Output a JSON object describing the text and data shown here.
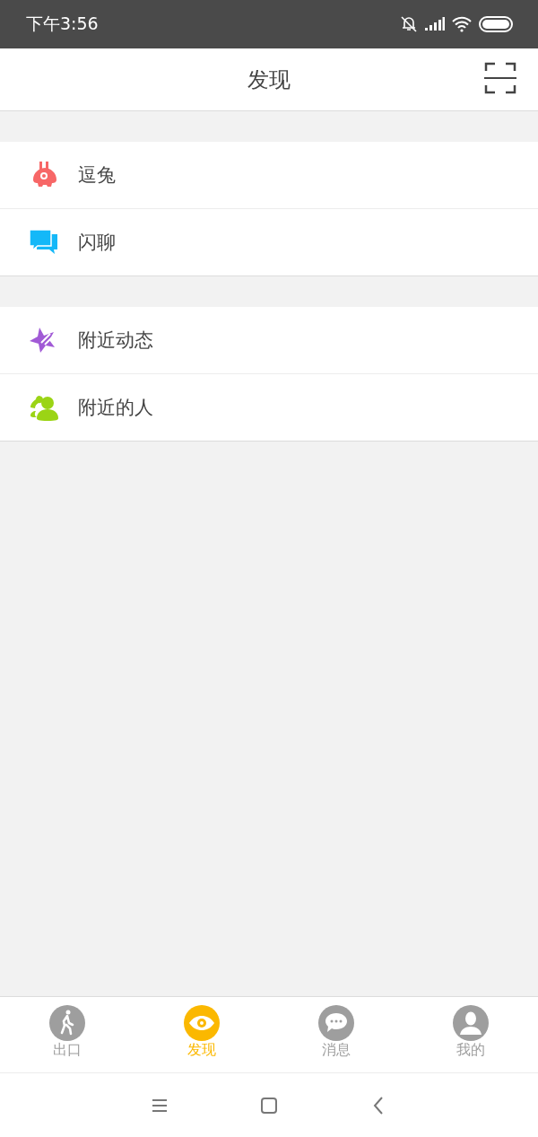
{
  "status_bar": {
    "time": "下午3:56"
  },
  "header": {
    "title": "发现"
  },
  "groups": [
    {
      "items": [
        {
          "label": "逗兔",
          "kind": "rabbit",
          "color": "#f76767"
        },
        {
          "label": "闪聊",
          "kind": "chat",
          "color": "#14b8f8"
        }
      ]
    },
    {
      "items": [
        {
          "label": "附近动态",
          "kind": "star",
          "color": "#a15ad6"
        },
        {
          "label": "附近的人",
          "kind": "people",
          "color": "#9bd415"
        }
      ]
    }
  ],
  "tabs": [
    {
      "label": "出口",
      "kind": "walk",
      "selected": false
    },
    {
      "label": "发现",
      "kind": "eye",
      "selected": true
    },
    {
      "label": "消息",
      "kind": "message",
      "selected": false
    },
    {
      "label": "我的",
      "kind": "person",
      "selected": false
    }
  ]
}
